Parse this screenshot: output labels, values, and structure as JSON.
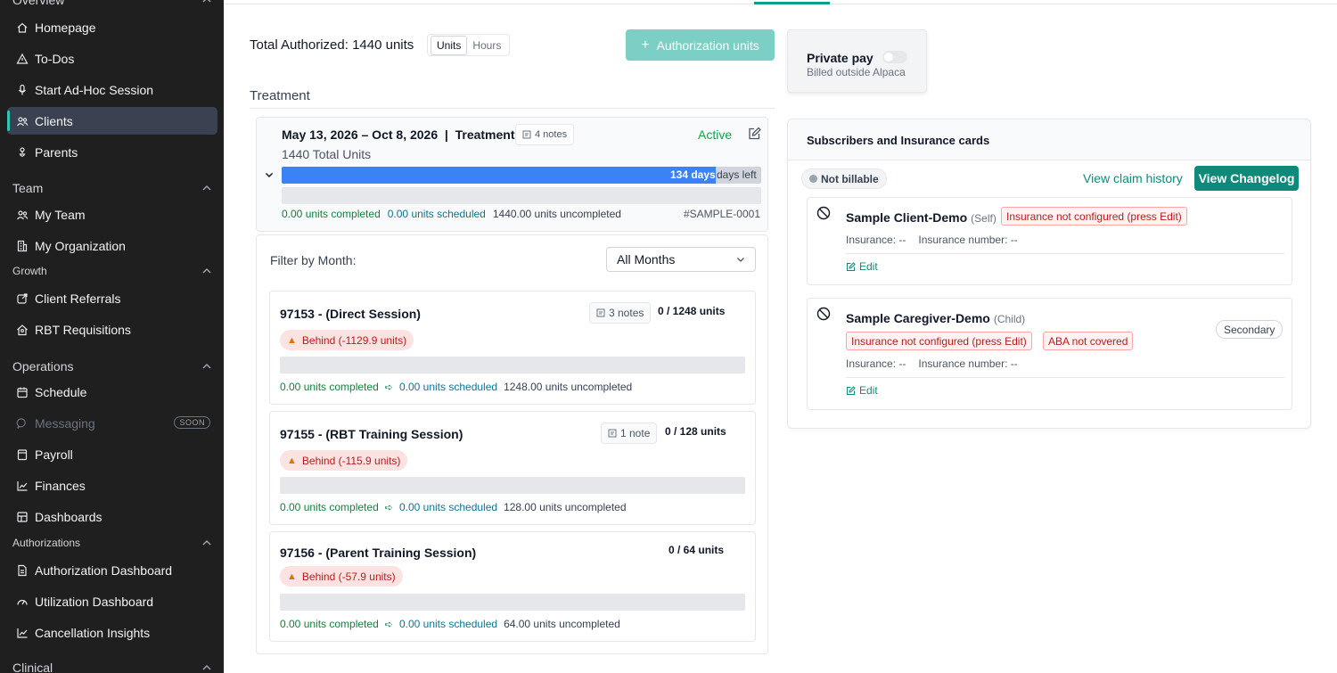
{
  "sidebar": {
    "overview_label": "Overview",
    "overview_items": [
      "Homepage",
      "To-Dos",
      "Start Ad-Hoc Session",
      "Clients",
      "Parents"
    ],
    "team_label": "Team",
    "team_items": [
      "My Team",
      "My Organization"
    ],
    "growth_label": "Growth",
    "growth_items": [
      "Client Referrals",
      "RBT Requisitions"
    ],
    "operations_label": "Operations",
    "operations_items": [
      "Schedule",
      "Messaging",
      "Payroll",
      "Finances",
      "Dashboards"
    ],
    "soon_badge": "SOON",
    "authorizations_label": "Authorizations",
    "authorizations_items": [
      "Authorization Dashboard",
      "Utilization Dashboard",
      "Cancellation Insights"
    ],
    "clinical_label": "Clinical",
    "active_item": "Clients"
  },
  "main": {
    "total_authorized": "Total Authorized: 1440 units",
    "units_toggle": "Units",
    "hours_toggle": "Hours",
    "authorization_button": "Authorization units",
    "treatment_heading": "Treatment",
    "plan": {
      "date_range": "May 13, 2026 – Oct 8, 2026  |  Treatment",
      "notes": "4 notes",
      "status": "Active",
      "total_units": "1440 Total Units",
      "days_value": "134 days",
      "days_left": "days left",
      "days_progress_pct": 90.5,
      "completed": "0.00 units completed",
      "scheduled": "0.00 units scheduled",
      "uncompleted": "1440.00 units uncompleted",
      "id": "#SAMPLE-0001"
    },
    "filter_label": "Filter by Month:",
    "month_select": "All Months",
    "codes": [
      {
        "title": "97153 - (Direct Session)",
        "notes": "3 notes",
        "units": "0 / 1248 units",
        "behind": "Behind (-1129.9 units)",
        "completed": "0.00 units completed",
        "scheduled": "0.00 units scheduled",
        "uncompleted": "1248.00 units uncompleted"
      },
      {
        "title": "97155 - (RBT Training Session)",
        "notes": "1 note",
        "units": "0 / 128 units",
        "behind": "Behind (-115.9 units)",
        "completed": "0.00 units completed",
        "scheduled": "0.00 units scheduled",
        "uncompleted": "128.00 units uncompleted"
      },
      {
        "title": "97156 - (Parent Training Session)",
        "notes": "",
        "units": "0 / 64 units",
        "behind": "Behind (-57.9 units)",
        "completed": "0.00 units completed",
        "scheduled": "0.00 units scheduled",
        "uncompleted": "64.00 units uncompleted"
      }
    ]
  },
  "right": {
    "private_pay_title": "Private pay",
    "private_pay_sub": "Billed outside Alpaca",
    "subs_title": "Subscribers and Insurance cards",
    "not_billable": "Not billable",
    "view_claim_history": "View claim history",
    "view_changelog": "View Changelog",
    "cards": [
      {
        "name": "Sample Client-Demo",
        "relation": "(Self)",
        "warnings": [
          "Insurance not configured (press Edit)"
        ],
        "insurance": "Insurance: --",
        "insurance_number": "Insurance number: --",
        "edit": "Edit",
        "badge": ""
      },
      {
        "name": "Sample Caregiver-Demo",
        "relation": "(Child)",
        "warnings": [
          "Insurance not configured (press Edit)",
          "ABA not covered"
        ],
        "insurance": "Insurance: --",
        "insurance_number": "Insurance number: --",
        "edit": "Edit",
        "badge": "Secondary"
      }
    ]
  }
}
